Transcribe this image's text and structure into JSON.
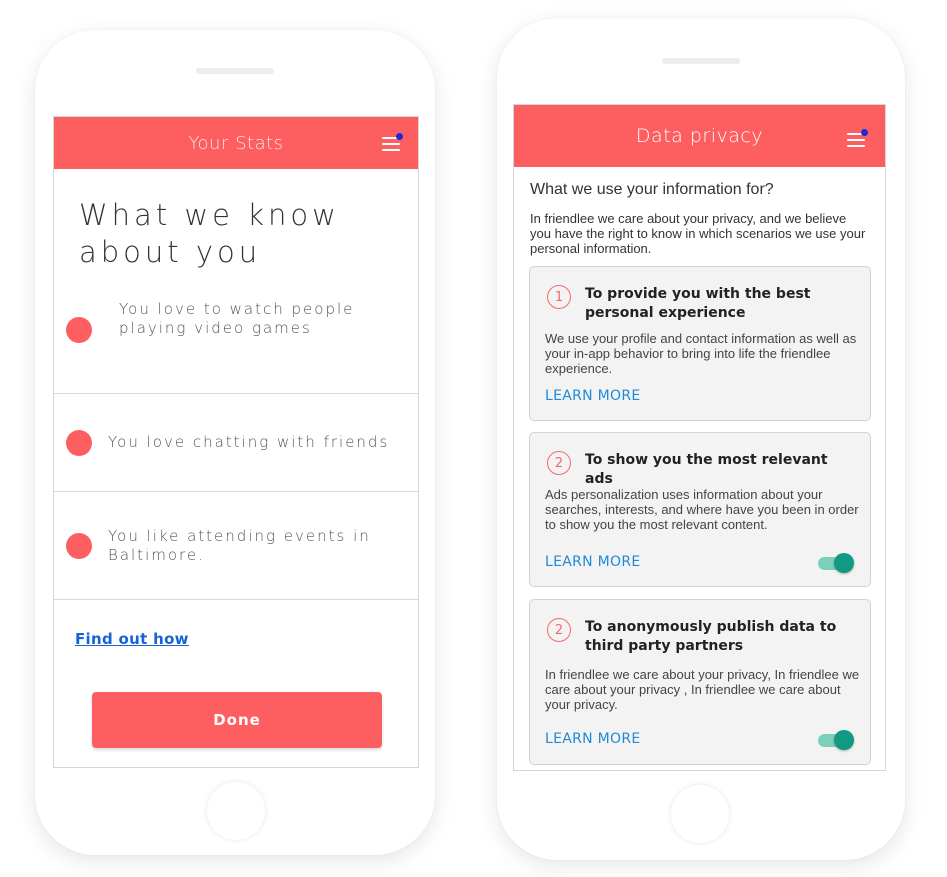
{
  "left": {
    "header": {
      "title": "Your Stats"
    },
    "heading": "What we know about you",
    "stats": [
      "You love to watch people playing video games",
      "You love chatting with friends",
      "You like attending events in Baltimore."
    ],
    "link": "Find out how",
    "done_label": "Done"
  },
  "right": {
    "header": {
      "title": "Data privacy"
    },
    "question": "What we use your information for?",
    "intro": "In friendlee we care about your privacy, and we believe you have the right to know in which scenarios we use your personal information.",
    "cards": [
      {
        "number": "1",
        "title": "To provide you with the best personal experience",
        "body": "We use your profile and contact information as well as your in-app behavior to bring into life the friendlee experience.",
        "link": "LEARN MORE",
        "toggle": null
      },
      {
        "number": "2",
        "title": "To show you the most relevant ads",
        "body": "Ads personalization uses information about your searches, interests, and where have you been in order to show you the most relevant content.",
        "link": "LEARN MORE",
        "toggle": true
      },
      {
        "number": "2",
        "title": "To anonymously publish data to third party  partners",
        "body": "In friendlee we care about your privacy, In friendlee we care about your privacy , In friendlee we care about your privacy.",
        "link": "LEARN MORE",
        "toggle": true
      }
    ]
  },
  "colors": {
    "accent": "#fd5e5f",
    "link": "#1f8ad8",
    "toggle": "#109a82",
    "notification_dot": "#1a2bd6"
  },
  "icons": [
    "hamburger-menu-icon",
    "notification-dot-icon",
    "bullet-dot-icon",
    "toggle-switch-icon"
  ]
}
